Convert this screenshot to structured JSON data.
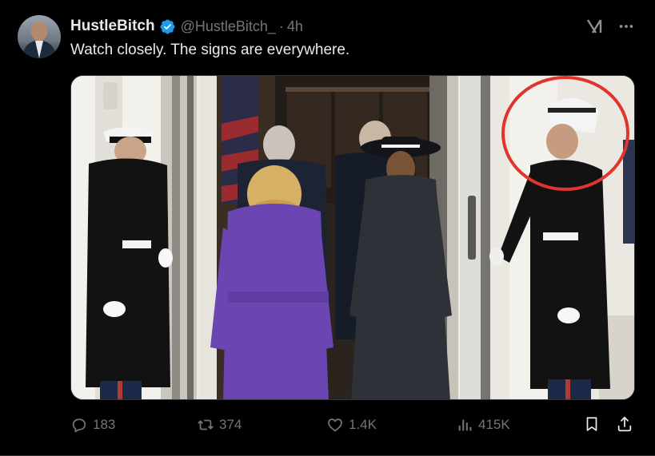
{
  "post": {
    "author_name": "HustleBitch",
    "author_handle": "@HustleBitch_",
    "separator": "·",
    "time": "4h",
    "text": "Watch closely. The signs are everywhere."
  },
  "icons": {
    "verified": "verified-badge-icon",
    "grok": "grok-icon",
    "more": "more-options-icon",
    "reply": "reply-icon",
    "repost": "repost-icon",
    "like": "like-icon",
    "views": "views-icon",
    "bookmark": "bookmark-icon",
    "share": "share-icon"
  },
  "actions": {
    "replies": "183",
    "reposts": "374",
    "likes": "1.4K",
    "views": "415K"
  },
  "colors": {
    "background": "#000000",
    "text": "#e7e9ea",
    "muted": "#71767b",
    "verified": "#1d9bf0",
    "highlight_circle": "#e0342e"
  }
}
